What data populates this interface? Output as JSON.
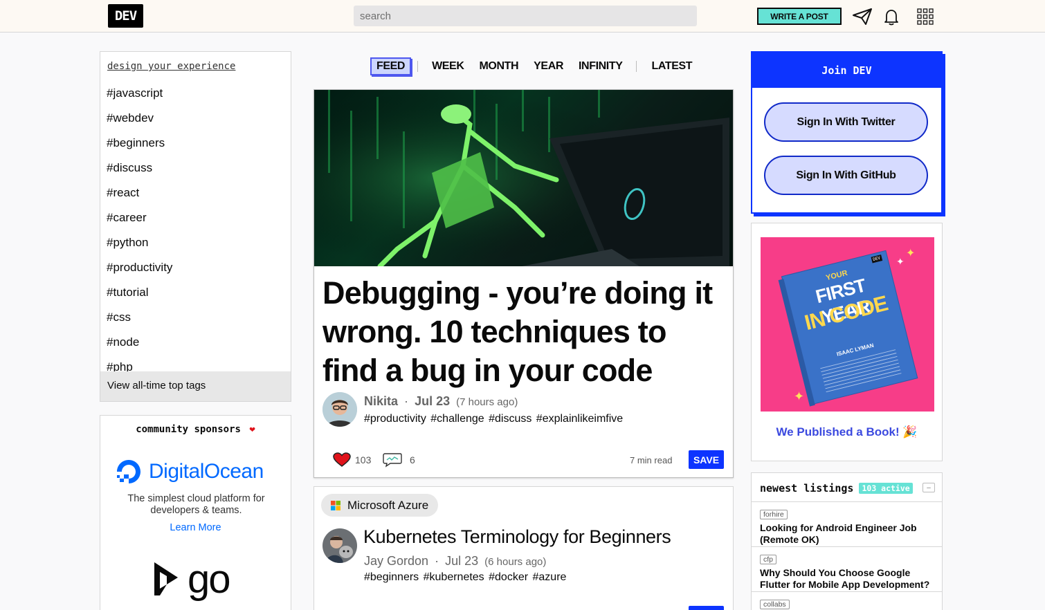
{
  "header": {
    "logo_text": "DEV",
    "search_placeholder": "search",
    "write_post_label": "WRITE A POST",
    "icons": [
      "paper-plane-icon",
      "bell-icon",
      "apps-grid-icon"
    ]
  },
  "left_sidebar": {
    "design_link": "design your experience",
    "tags": [
      "#javascript",
      "#webdev",
      "#beginners",
      "#discuss",
      "#react",
      "#career",
      "#python",
      "#productivity",
      "#tutorial",
      "#css",
      "#node",
      "#php"
    ],
    "view_all_label": "View all-time top tags",
    "sponsors": {
      "title": "community sponsors",
      "digitalocean": {
        "name": "DigitalOcean",
        "description": "The simplest cloud platform for developers & teams.",
        "link_label": "Learn More"
      },
      "second_logo_text": "go"
    }
  },
  "feed_nav": {
    "tabs": [
      "FEED",
      "WEEK",
      "MONTH",
      "YEAR",
      "INFINITY",
      "LATEST"
    ],
    "active": "FEED"
  },
  "main_article": {
    "title": "Debugging - you’re doing it wrong. 10 techniques to find a bug in your code",
    "author": "Nikita",
    "date": "Jul 23",
    "ago": "(7 hours ago)",
    "tags": "#productivity  #challenge  #discuss  #explainlikeimfive",
    "reactions": "103",
    "comments": "6",
    "read_time": "7 min read",
    "save_label": "SAVE"
  },
  "second_article": {
    "org": "Microsoft Azure",
    "title": "Kubernetes Terminology for Beginners",
    "author": "Jay Gordon",
    "date": "Jul 23",
    "ago": "(6 hours ago)",
    "tags": "#beginners  #kubernetes  #docker  #azure"
  },
  "right_sidebar": {
    "join": {
      "title": "Join DEV",
      "twitter_label": "Sign In With Twitter",
      "github_label": "Sign In With GitHub"
    },
    "book": {
      "cover_your": "YOUR",
      "cover_title_1": "FIRST YEAR",
      "cover_title_2": "IN CODE",
      "cover_author": "ISAAC LYMAN",
      "cover_badge": "DEV",
      "link_label": "We Published a Book! 🎉"
    },
    "listings": {
      "title": "newest listings",
      "active_badge": "103 active",
      "collapse": "–",
      "items": [
        {
          "category": "forhire",
          "title": "Looking for Android Engineer Job (Remote OK)"
        },
        {
          "category": "cfp",
          "title": "Why Should You Choose Google Flutter for Mobile App Development?"
        },
        {
          "category": "collabs",
          "title": ""
        }
      ]
    }
  },
  "colors": {
    "accent_blue": "#0d34ff",
    "teal": "#66e2d5",
    "heart_red": "#e0131b",
    "book_pink": "#f73d88"
  }
}
